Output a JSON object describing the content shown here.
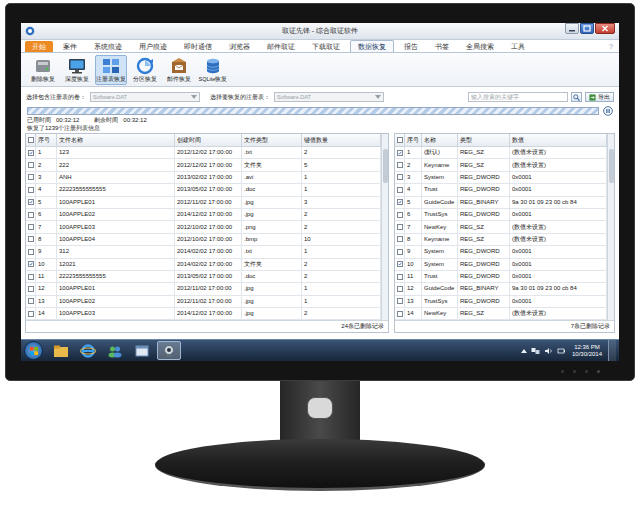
{
  "window": {
    "title": "取证先锋 - 综合取证软件",
    "help": "?"
  },
  "ribbon_tabs": [
    {
      "label": "开始",
      "kind": "app",
      "selected": false
    },
    {
      "label": "案件",
      "kind": "tab",
      "selected": false
    },
    {
      "label": "系统痕迹",
      "kind": "tab",
      "selected": false
    },
    {
      "label": "用户痕迹",
      "kind": "tab",
      "selected": false
    },
    {
      "label": "即时通信",
      "kind": "tab",
      "selected": false
    },
    {
      "label": "浏览器",
      "kind": "tab",
      "selected": false
    },
    {
      "label": "邮件取证",
      "kind": "tab",
      "selected": false
    },
    {
      "label": "下载取证",
      "kind": "tab",
      "selected": false
    },
    {
      "label": "数据恢复",
      "kind": "tab",
      "selected": true
    },
    {
      "label": "报告",
      "kind": "tab",
      "selected": false
    },
    {
      "label": "书签",
      "kind": "tab",
      "selected": false
    },
    {
      "label": "全局搜索",
      "kind": "tab",
      "selected": false
    },
    {
      "label": "工具",
      "kind": "tab",
      "selected": false
    }
  ],
  "toolbar": [
    {
      "label": "删除恢复",
      "selected": false
    },
    {
      "label": "深度恢复",
      "selected": false
    },
    {
      "label": "注册表恢复",
      "selected": true
    },
    {
      "label": "分区恢复",
      "selected": false
    },
    {
      "label": "邮件恢复",
      "selected": false
    },
    {
      "label": "SQLite恢复",
      "selected": false
    }
  ],
  "selectors": [
    {
      "label": "选择包含注册表的卷：",
      "value": "Software.DAT",
      "disabled": true
    },
    {
      "label": "选择要恢复的注册表：",
      "value": "Software.DAT",
      "disabled": true
    }
  ],
  "search": {
    "placeholder": "输入搜索的关键字",
    "export": "导出"
  },
  "progress": {
    "level": 1
  },
  "elapsed": {
    "label": "已用时间",
    "value": "00:32:12"
  },
  "remaining": {
    "label": "剩余时间",
    "value": "00:32:12"
  },
  "summary": "恢复了1239个注册列表信息",
  "files_table": {
    "all_checked": false,
    "columns": [
      "序号",
      "文件名称",
      "创建时间",
      "文件类型",
      "键值数量"
    ],
    "rows": [
      {
        "checked": true,
        "cells": [
          "1",
          "123",
          "2012/12/02 17:00:00",
          ".txt",
          "2"
        ]
      },
      {
        "checked": false,
        "cells": [
          "2",
          "222",
          "2012/12/02 17:00:00",
          "文件夹",
          "5"
        ]
      },
      {
        "checked": false,
        "cells": [
          "3",
          "ANH",
          "2013/02/02 17:00:00",
          ".avi",
          "1"
        ]
      },
      {
        "checked": false,
        "cells": [
          "4",
          "22223555555555",
          "2013/05/02 17:00:00",
          ".doc",
          "1"
        ]
      },
      {
        "checked": true,
        "cells": [
          "5",
          "100APPLE01",
          "2012/11/02 17:00:00",
          ".jpg",
          "3"
        ]
      },
      {
        "checked": false,
        "cells": [
          "6",
          "100APPLE02",
          "2014/12/02 17:00:00",
          ".jpg",
          "2"
        ]
      },
      {
        "checked": false,
        "cells": [
          "7",
          "100APPLE03",
          "2012/10/02 17:00:00",
          ".png",
          "2"
        ]
      },
      {
        "checked": false,
        "cells": [
          "8",
          "100APPLE04",
          "2012/10/02 17:00:00",
          ".bmp",
          "10"
        ]
      },
      {
        "checked": false,
        "cells": [
          "9",
          "312",
          "2014/02/02 17:00:00",
          ".txt",
          "1"
        ]
      },
      {
        "checked": true,
        "cells": [
          "10",
          "12021",
          "2014/02/02 17:00:00",
          "文件夹",
          "2"
        ]
      },
      {
        "checked": false,
        "cells": [
          "11",
          "22223555555555",
          "2013/05/02 17:00:00",
          ".doc",
          "2"
        ]
      },
      {
        "checked": false,
        "cells": [
          "12",
          "100APPLE01",
          "2012/11/02 17:00:00",
          ".jpg",
          "1"
        ]
      },
      {
        "checked": false,
        "cells": [
          "13",
          "100APPLE02",
          "2012/11/02 17:00:00",
          ".jpg",
          "1"
        ]
      },
      {
        "checked": false,
        "cells": [
          "14",
          "100APPLE03",
          "2014/12/02 17:00:00",
          ".jpg",
          "2"
        ]
      }
    ],
    "footer": "24条已删除记录"
  },
  "values_table": {
    "all_checked": false,
    "columns": [
      "序号",
      "名称",
      "类型",
      "数值"
    ],
    "rows": [
      {
        "checked": true,
        "cells": [
          "1",
          "(默认)",
          "REG_SZ",
          "(数值未设置)"
        ]
      },
      {
        "checked": false,
        "cells": [
          "2",
          "Keyname",
          "REG_SZ",
          "(数值未设置)"
        ]
      },
      {
        "checked": false,
        "cells": [
          "3",
          "System",
          "REG_DWORD",
          "0x0001"
        ]
      },
      {
        "checked": false,
        "cells": [
          "4",
          "Trust",
          "REG_DWORD",
          "0x0001"
        ]
      },
      {
        "checked": true,
        "cells": [
          "5",
          "GuideCode",
          "REG_BINARY",
          "9a 30 01 09 23 00 cb 84"
        ]
      },
      {
        "checked": false,
        "cells": [
          "6",
          "TrustSys",
          "REG_DWORD",
          "0x0001"
        ]
      },
      {
        "checked": false,
        "cells": [
          "7",
          "NewKey",
          "REG_SZ",
          "(数值未设置)"
        ]
      },
      {
        "checked": false,
        "cells": [
          "8",
          "Keyname",
          "REG_SZ",
          "(数值未设置)"
        ]
      },
      {
        "checked": false,
        "cells": [
          "9",
          "System",
          "REG_DWORD",
          "0x0001"
        ]
      },
      {
        "checked": true,
        "cells": [
          "10",
          "System",
          "REG_DWORD",
          "0x0001"
        ]
      },
      {
        "checked": false,
        "cells": [
          "11",
          "Trust",
          "REG_DWORD",
          "0x0001"
        ]
      },
      {
        "checked": false,
        "cells": [
          "12",
          "GuideCode",
          "REG_BINARY",
          "9a 30 01 09 23 00 cb 84"
        ]
      },
      {
        "checked": false,
        "cells": [
          "13",
          "TrustSys",
          "REG_DWORD",
          "0x0001"
        ]
      },
      {
        "checked": false,
        "cells": [
          "14",
          "NewKey",
          "REG_SZ",
          "(数值未设置)"
        ]
      }
    ],
    "footer": "7条已删除记录"
  },
  "taskbar": {
    "time": "12:36 PM",
    "date": "10/30/2014"
  }
}
